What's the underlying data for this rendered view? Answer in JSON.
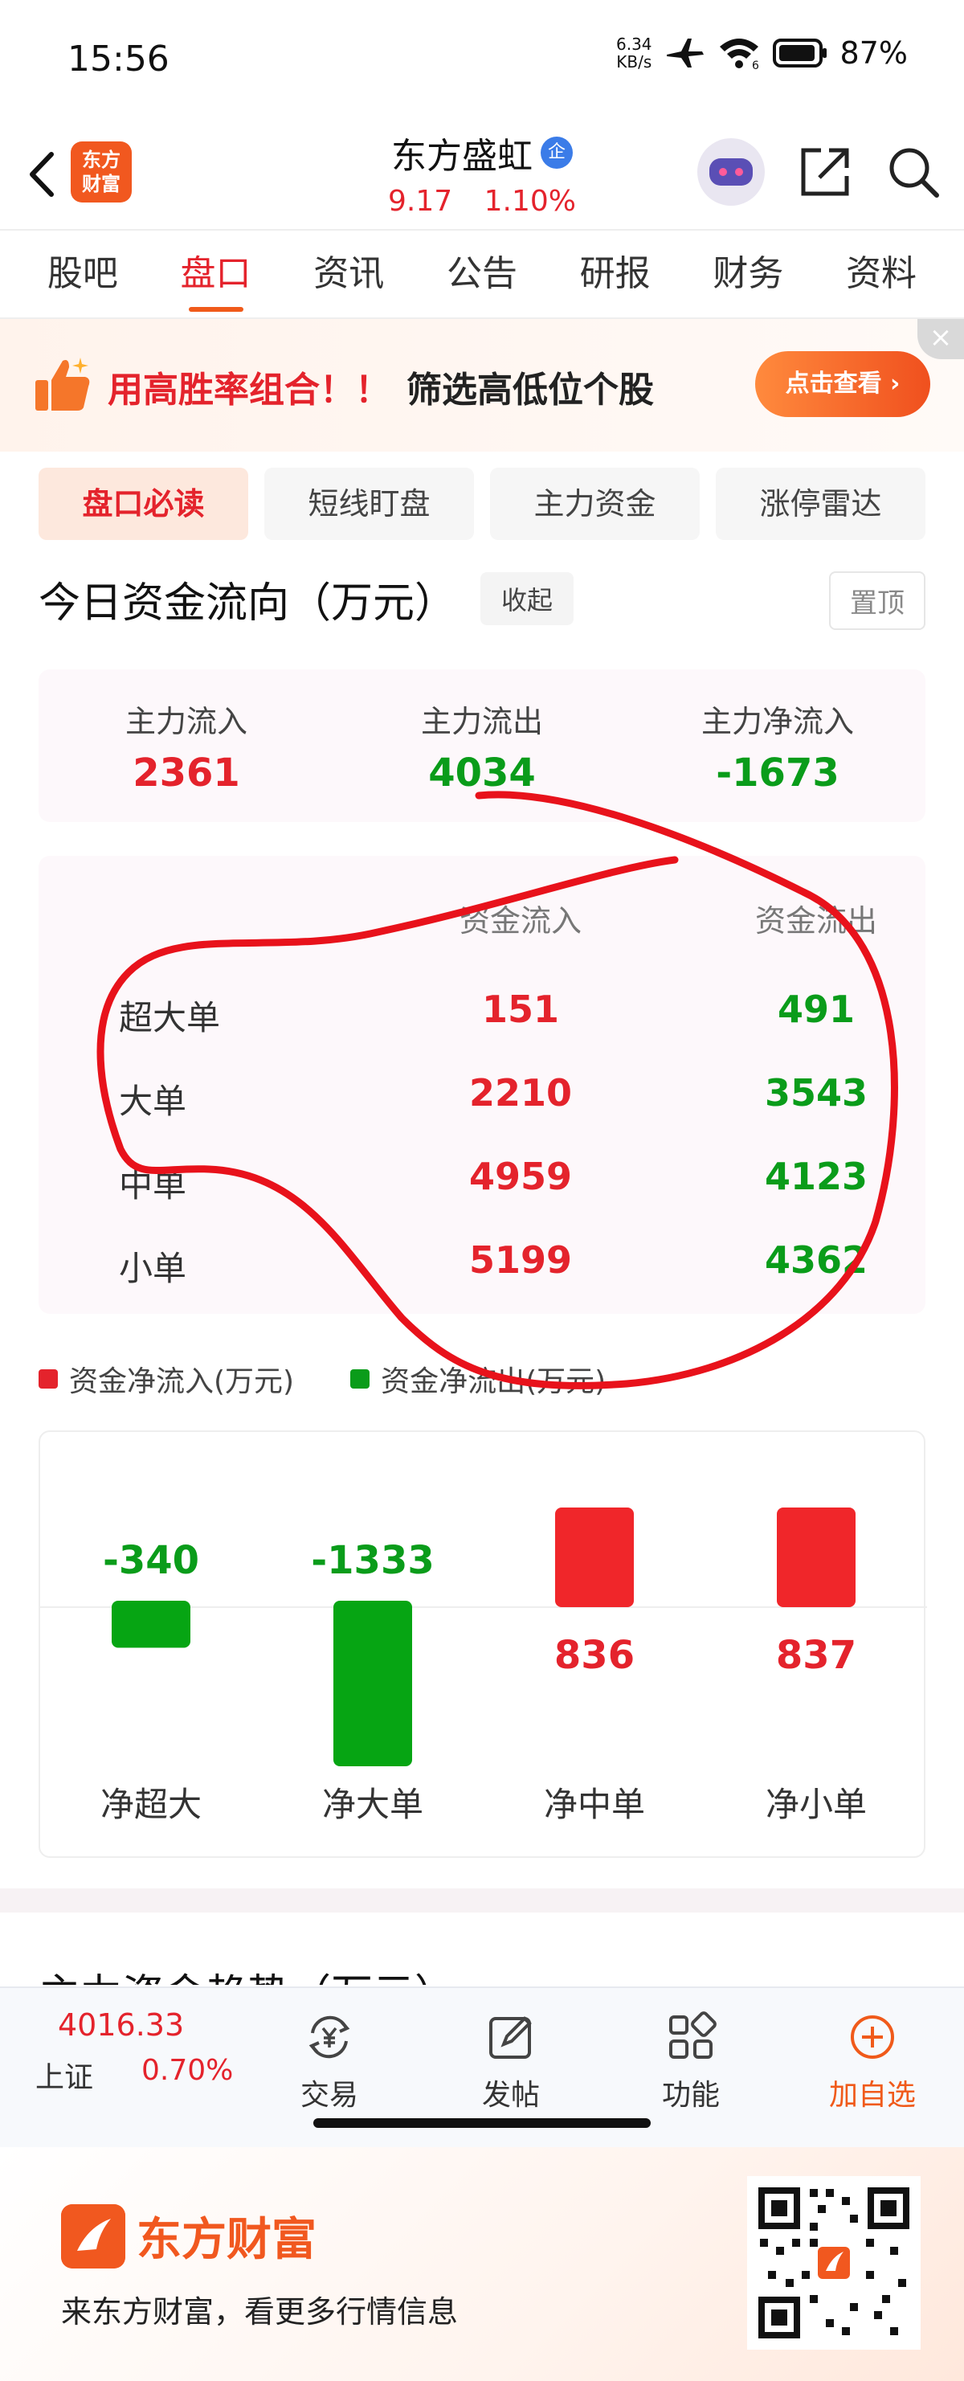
{
  "status_bar": {
    "time": "15:56",
    "net_speed_value": "6.34",
    "net_speed_unit": "KB/s",
    "wifi_badge": "6",
    "battery": "87%"
  },
  "header": {
    "title": "东方盛虹",
    "entity_badge": "企",
    "logo_line1": "东方",
    "logo_line2": "财富",
    "price": "9.17",
    "change_pct": "1.10%"
  },
  "tabs": [
    "股吧",
    "盘口",
    "资讯",
    "公告",
    "研报",
    "财务",
    "资料"
  ],
  "active_tab": "盘口",
  "banner": {
    "text_highlight": "用高胜率组合！！",
    "text_main": "筛选高低位个股",
    "button": "点击查看 ›",
    "close": "×"
  },
  "subtabs": [
    "盘口必读",
    "短线盯盘",
    "主力资金",
    "涨停雷达"
  ],
  "section": {
    "title": "今日资金流向（万元）",
    "fold_button": "收起",
    "pin_button": "置顶"
  },
  "summary": [
    {
      "label": "主力流入",
      "value": "2361",
      "color": "red"
    },
    {
      "label": "主力流出",
      "value": "4034",
      "color": "green"
    },
    {
      "label": "主力净流入",
      "value": "-1673",
      "color": "green"
    }
  ],
  "detail": {
    "col_in": "资金流入",
    "col_out": "资金流出",
    "rows": [
      {
        "label": "超大单",
        "in": "151",
        "out": "491"
      },
      {
        "label": "大单",
        "in": "2210",
        "out": "3543"
      },
      {
        "label": "中单",
        "in": "4959",
        "out": "4123"
      },
      {
        "label": "小单",
        "in": "5199",
        "out": "4362"
      }
    ]
  },
  "legend": {
    "inflow": "资金净流入(万元)",
    "outflow": "资金净流出(万元)"
  },
  "colors": {
    "red": "#e4232c",
    "green": "#0a9c1a",
    "bar_red": "#f0262a",
    "bar_green": "#06a513",
    "accent": "#f05a1a",
    "annotation": "#e8121b"
  },
  "chart_data": {
    "type": "bar",
    "categories": [
      "净超大",
      "净大单",
      "净中单",
      "净小单"
    ],
    "values": [
      -340,
      -1333,
      836,
      837
    ],
    "value_labels": [
      "-340",
      "-1333",
      "836",
      "837"
    ],
    "legend": [
      "资金净流入(万元)",
      "资金净流出(万元)"
    ],
    "note": "positive bars are shown in red, negative bars in green; positive bars appear visually capped"
  },
  "next_section_peek": "主力资金趋势（万元）",
  "bottom_nav": {
    "index_value": "4016.33",
    "index_name": "上证",
    "index_pct": "0.70%",
    "items": [
      {
        "label": "交易",
        "icon": "yuan-exchange-icon"
      },
      {
        "label": "发帖",
        "icon": "edit-post-icon"
      },
      {
        "label": "功能",
        "icon": "grid-apps-icon"
      },
      {
        "label": "加自选",
        "icon": "add-circle-icon"
      }
    ]
  },
  "footer": {
    "brand": "东方财富",
    "tagline": "来东方财富，看更多行情信息"
  }
}
